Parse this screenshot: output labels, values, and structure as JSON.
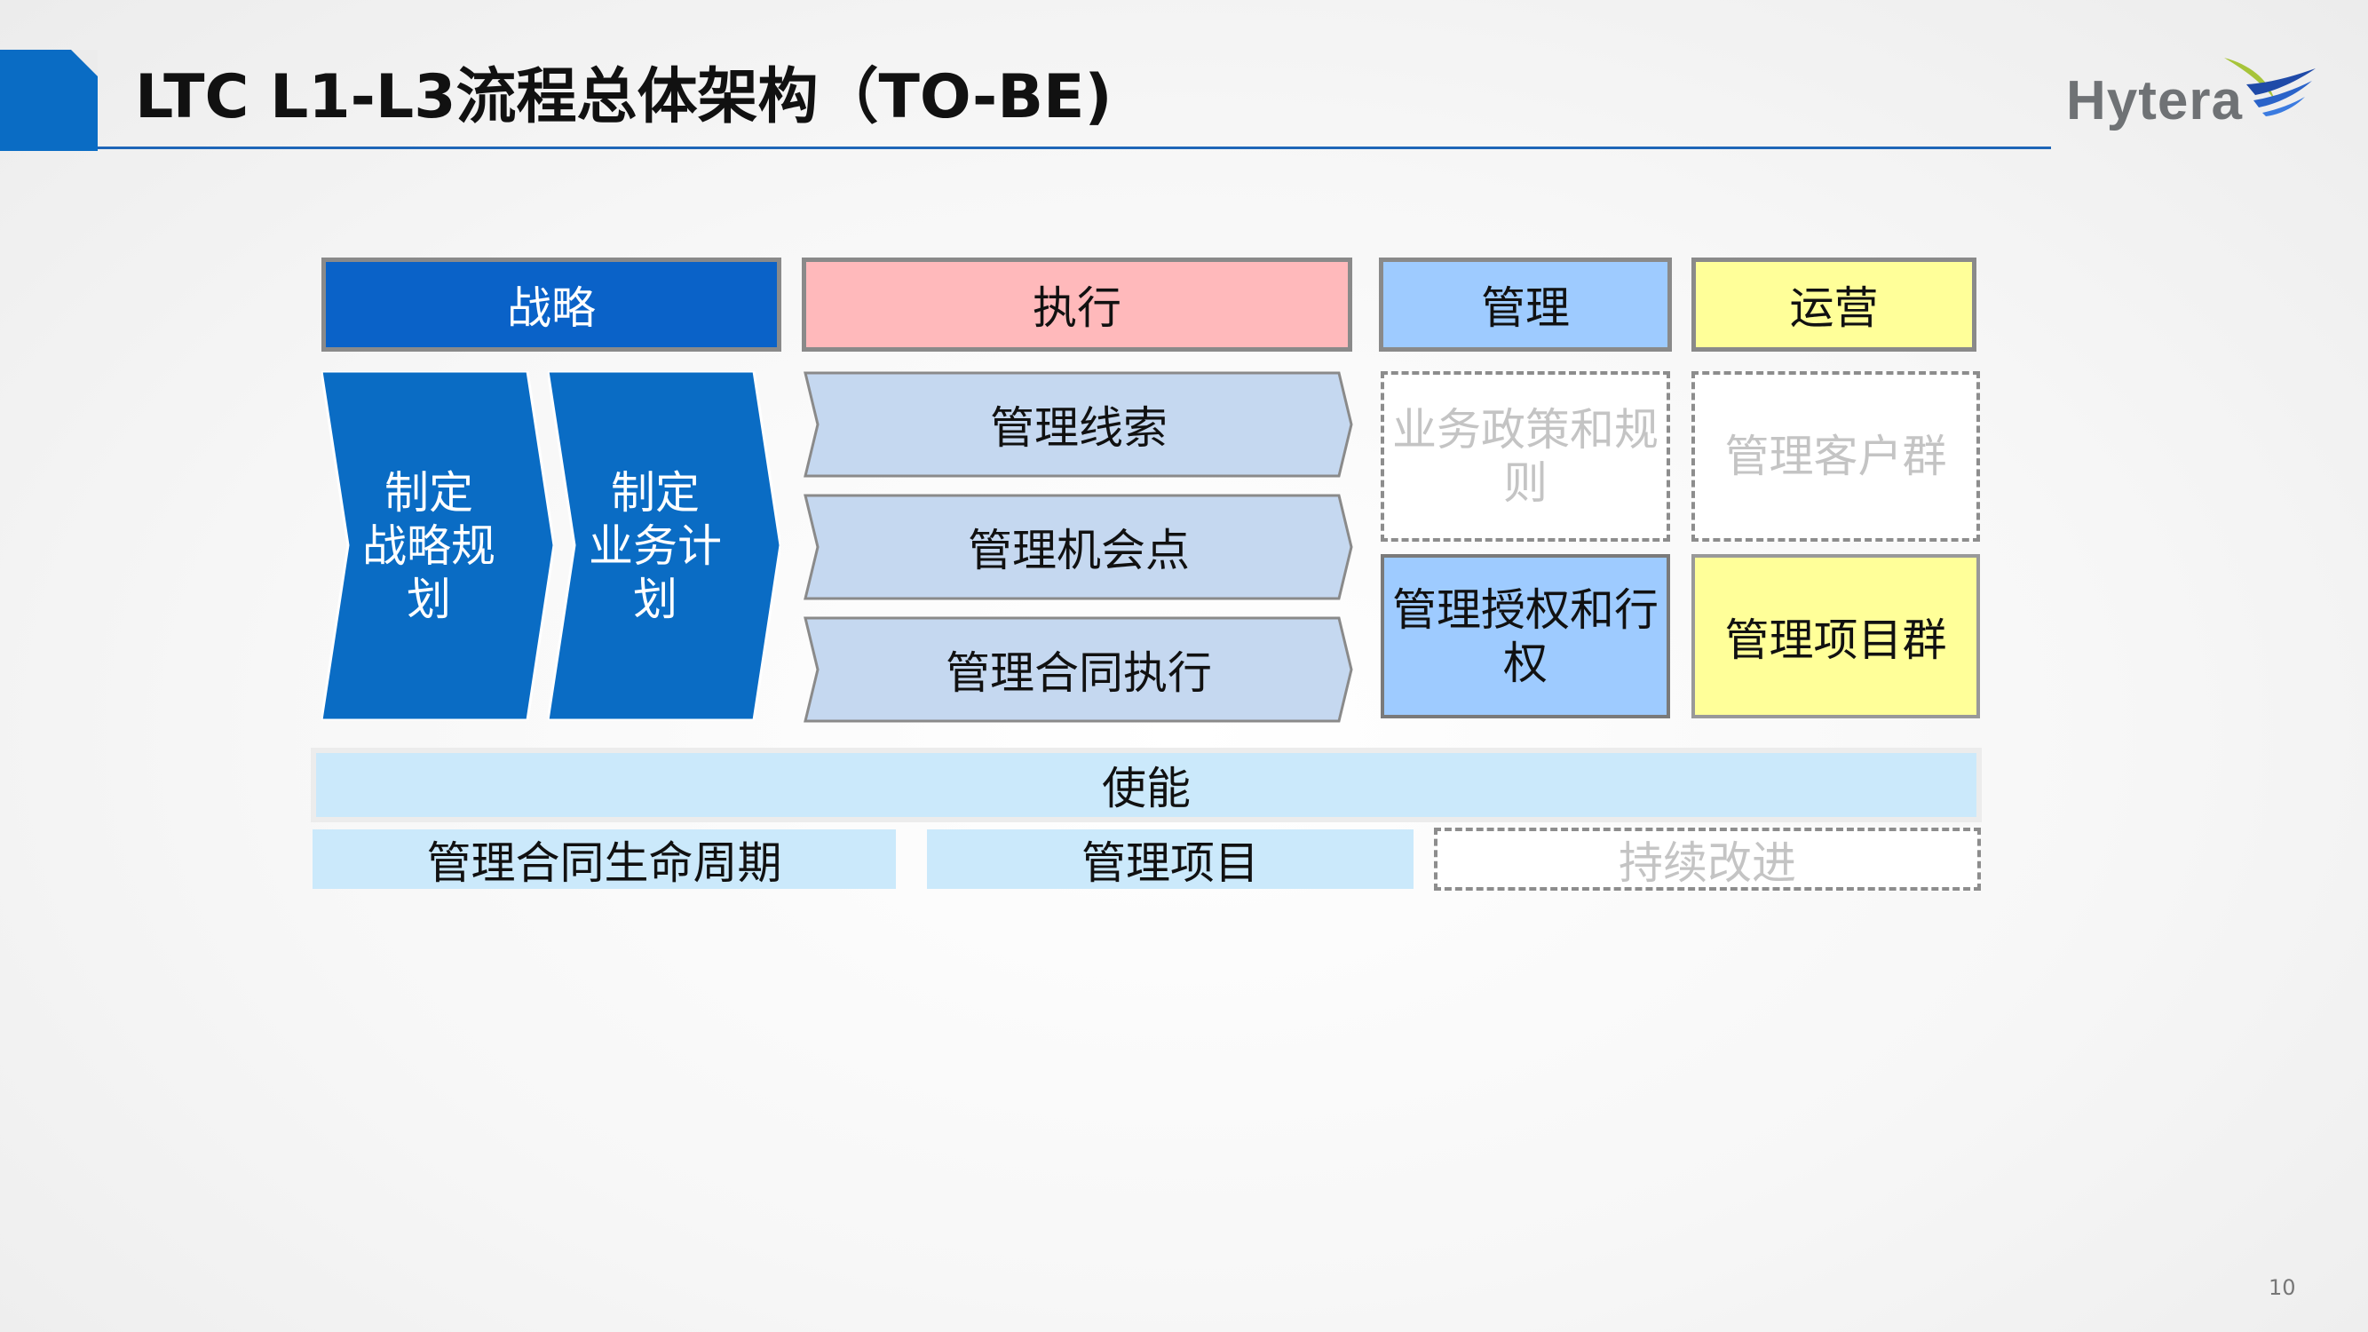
{
  "header": {
    "title": "LTC L1-L3流程总体架构（TO-BE)",
    "logo_text": "Hytera",
    "page_number": "10"
  },
  "columns": {
    "strategy": "战略",
    "execute": "执行",
    "manage": "管理",
    "operate": "运营"
  },
  "strategy_steps": [
    {
      "label": "制定\n战略规\n划"
    },
    {
      "label": "制定\n业务计\n划"
    }
  ],
  "execute_steps": [
    {
      "label": "管理线索"
    },
    {
      "label": "管理机会点"
    },
    {
      "label": "管理合同执行"
    }
  ],
  "manage_items": [
    {
      "label": "业务政策和规\n则",
      "status": "planned"
    },
    {
      "label": "管理授权和行\n权",
      "status": "active"
    }
  ],
  "operate_items": [
    {
      "label": "管理客户群",
      "status": "planned"
    },
    {
      "label": "管理项目群",
      "status": "active"
    }
  ],
  "enable": {
    "label": "使能",
    "items": [
      {
        "label": "管理合同生命周期",
        "status": "active"
      },
      {
        "label": "管理项目",
        "status": "active"
      },
      {
        "label": "持续改进",
        "status": "planned"
      }
    ]
  },
  "colors": {
    "accent_blue": "#0a6cc4",
    "strategy_blue": "#0a62c8",
    "execute_pink": "#ffb9bb",
    "manage_blue": "#9ecbff",
    "operate_yellow": "#ffff99",
    "process_lightblue": "#c5d8f0",
    "enable_lightblue": "#cbe9fb",
    "planned_text_gray": "#c4c4c4"
  }
}
